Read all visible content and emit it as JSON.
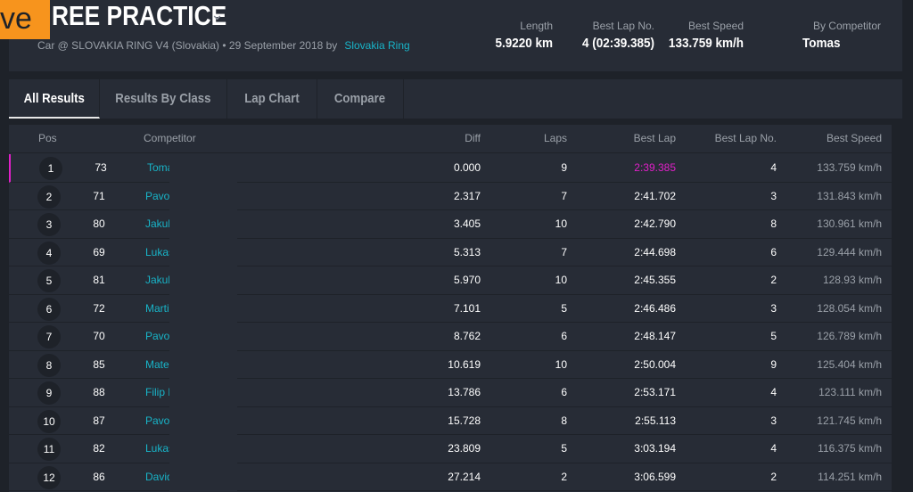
{
  "logo_text": "ve",
  "header": {
    "title": "REE PRACTICE",
    "subtitle": "Car @ SLOVAKIA RING V4 (Slovakia) • 29 September 2018 by",
    "organizer": "Slovakia Ring",
    "stats": [
      {
        "label": "Length",
        "value": "5.9220 km"
      },
      {
        "label": "Best Lap No.",
        "value": "4 (02:39.385)"
      },
      {
        "label": "Best Speed",
        "value": "133.759 km/h"
      },
      {
        "label": "By Competitor",
        "value": "Tomas"
      }
    ]
  },
  "tabs": [
    "All Results",
    "Results By Class",
    "Lap Chart",
    "Compare"
  ],
  "columns": {
    "pos": "Pos",
    "competitor": "Competitor",
    "diff": "Diff",
    "laps": "Laps",
    "best_lap": "Best Lap",
    "best_lap_no": "Best Lap No.",
    "best_speed": "Best Speed"
  },
  "colors": {
    "accent": "#18b4c8",
    "best": "#e020c8",
    "logo": "#f7941d"
  },
  "rows": [
    [
      "1",
      "73",
      "Tomas",
      "0.000",
      "9",
      "2:39.385",
      "4",
      "133.759 km/h"
    ],
    [
      "2",
      "71",
      "Pavol I",
      "2.317",
      "7",
      "2:41.702",
      "3",
      "131.843 km/h"
    ],
    [
      "3",
      "80",
      "Jakub",
      "3.405",
      "10",
      "2:42.790",
      "8",
      "130.961 km/h"
    ],
    [
      "4",
      "69",
      "Lukas",
      "5.313",
      "7",
      "2:44.698",
      "6",
      "129.444 km/h"
    ],
    [
      "5",
      "81",
      "Jakub",
      "5.970",
      "10",
      "2:45.355",
      "2",
      "128.93 km/h"
    ],
    [
      "6",
      "72",
      "Martin",
      "7.101",
      "5",
      "2:46.486",
      "3",
      "128.054 km/h"
    ],
    [
      "7",
      "70",
      "Pavol I",
      "8.762",
      "6",
      "2:48.147",
      "5",
      "126.789 km/h"
    ],
    [
      "8",
      "85",
      "Mate D",
      "10.619",
      "10",
      "2:50.004",
      "9",
      "125.404 km/h"
    ],
    [
      "9",
      "88",
      "Filip FI",
      "13.786",
      "6",
      "2:53.171",
      "4",
      "123.111 km/h"
    ],
    [
      "10",
      "87",
      "Pavol V",
      "15.728",
      "8",
      "2:55.113",
      "3",
      "121.745 km/h"
    ],
    [
      "11",
      "82",
      "Lukas",
      "23.809",
      "5",
      "3:03.194",
      "4",
      "116.375 km/h"
    ],
    [
      "12",
      "86",
      "David I",
      "27.214",
      "2",
      "3:06.599",
      "2",
      "114.251 km/h"
    ]
  ]
}
